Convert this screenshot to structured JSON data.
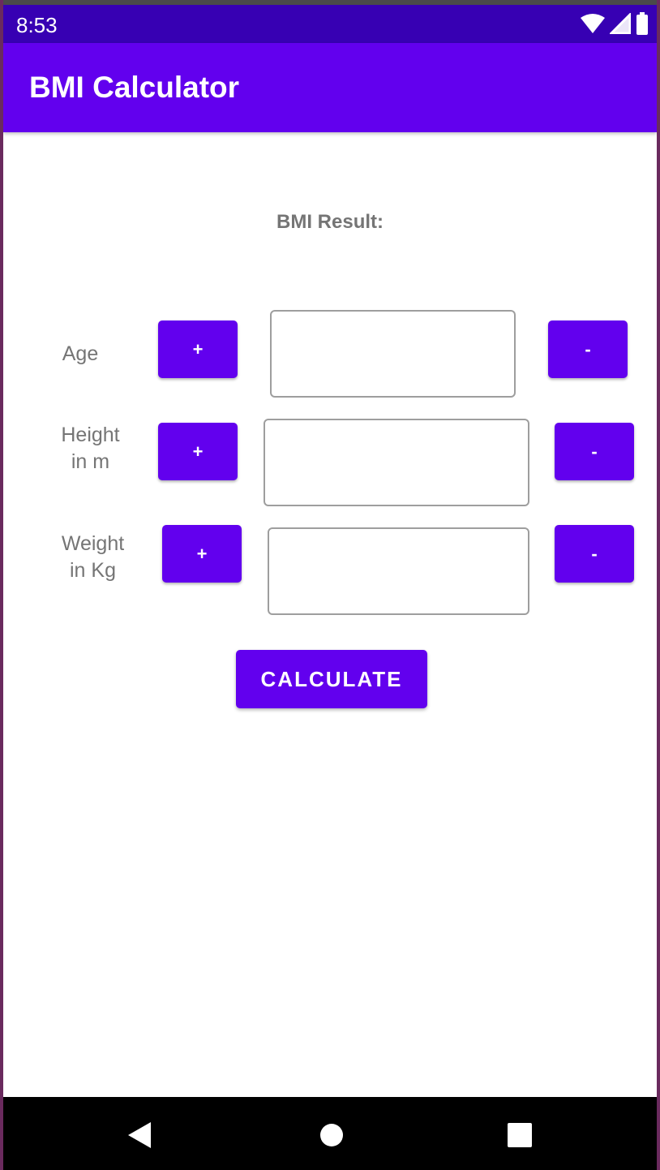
{
  "status_bar": {
    "time": "8:53",
    "icons": [
      "wifi-icon",
      "signal-icon",
      "battery-icon"
    ]
  },
  "app_bar": {
    "title": "BMI Calculator"
  },
  "result": {
    "label": "BMI Result:"
  },
  "rows": {
    "age": {
      "label": "Age",
      "plus": "+",
      "minus": "-",
      "value": ""
    },
    "height": {
      "label_line1": "Height",
      "label_line2": "in m",
      "plus": "+",
      "minus": "-",
      "value": ""
    },
    "weight": {
      "label_line1": "Weight",
      "label_line2": "in Kg",
      "plus": "+",
      "minus": "-",
      "value": ""
    }
  },
  "calculate": {
    "label": "CALCULATE"
  },
  "nav_bar": {
    "icons": [
      "back-icon",
      "home-icon",
      "recents-icon"
    ]
  },
  "colors": {
    "primary": "#6200ee",
    "primary_dark": "#3700b3",
    "text_secondary": "#757575"
  }
}
